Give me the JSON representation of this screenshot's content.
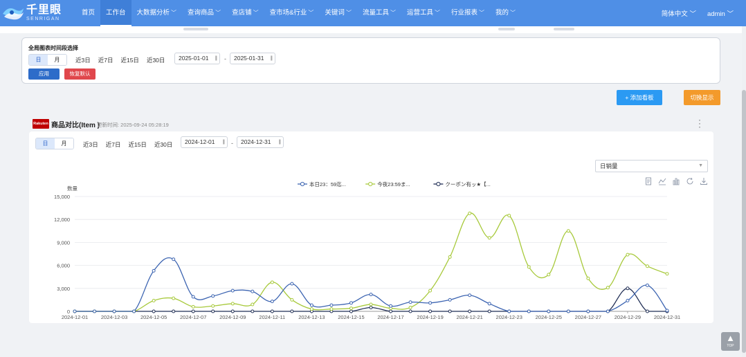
{
  "app": {
    "logo_cn": "千里眼",
    "logo_en": "SENRIGAN"
  },
  "nav": {
    "items": [
      {
        "label": "首页",
        "dropdown": false
      },
      {
        "label": "工作台",
        "dropdown": false,
        "active": true
      },
      {
        "label": "大数据分析",
        "dropdown": true
      },
      {
        "label": "查询商品",
        "dropdown": true
      },
      {
        "label": "查店铺",
        "dropdown": true
      },
      {
        "label": "查市场&行业",
        "dropdown": true
      },
      {
        "label": "关键词",
        "dropdown": true
      },
      {
        "label": "流量工具",
        "dropdown": true
      },
      {
        "label": "运营工具",
        "dropdown": true
      },
      {
        "label": "行业报表",
        "dropdown": true
      },
      {
        "label": "我的",
        "dropdown": true
      }
    ],
    "language": "简体中文",
    "user": "admin"
  },
  "global_filter": {
    "title": "全局图表时间段选择",
    "granularity": [
      "日",
      "月"
    ],
    "quick_ranges": [
      "近3日",
      "近7日",
      "近15日",
      "近30日"
    ],
    "start_date": "2025-01-01",
    "end_date": "2025-01-31",
    "separator": "-",
    "apply_label": "应用",
    "reset_label": "恢复默认"
  },
  "actions": {
    "add_board_label": "+ 添加看板",
    "switch_view_label": "切换显示"
  },
  "widget": {
    "brand": "Rakuten",
    "title": "商品对比(Item )",
    "updated": "更新时间: 2025-09-24 05:28:19",
    "granularity": [
      "日",
      "月"
    ],
    "quick_ranges": [
      "近3日",
      "近7日",
      "近15日",
      "近30日"
    ],
    "start_date": "2024-12-01",
    "end_date": "2024-12-31",
    "separator": "-",
    "metric": "日销量"
  },
  "chart_data": {
    "type": "line",
    "ylabel": "数量",
    "ylim": [
      0,
      15000
    ],
    "yticks": [
      "0",
      "3,000",
      "6,000",
      "9,000",
      "12,000",
      "15,000"
    ],
    "x": [
      "2024-12-01",
      "2024-12-02",
      "2024-12-03",
      "2024-12-04",
      "2024-12-05",
      "2024-12-06",
      "2024-12-07",
      "2024-12-08",
      "2024-12-09",
      "2024-12-10",
      "2024-12-11",
      "2024-12-12",
      "2024-12-13",
      "2024-12-14",
      "2024-12-15",
      "2024-12-16",
      "2024-12-17",
      "2024-12-18",
      "2024-12-19",
      "2024-12-20",
      "2024-12-21",
      "2024-12-22",
      "2024-12-23",
      "2024-12-24",
      "2024-12-25",
      "2024-12-26",
      "2024-12-27",
      "2024-12-28",
      "2024-12-29",
      "2024-12-30",
      "2024-12-31"
    ],
    "xticks": [
      "2024-12-01",
      "2024-12-03",
      "2024-12-05",
      "2024-12-07",
      "2024-12-09",
      "2024-12-11",
      "2024-12-13",
      "2024-12-15",
      "2024-12-17",
      "2024-12-19",
      "2024-12-21",
      "2024-12-23",
      "2024-12-25",
      "2024-12-27",
      "2024-12-29",
      "2024-12-31"
    ],
    "legend_position": "top-center",
    "series": [
      {
        "name": "本日23：59迄...",
        "color": "#3c64b1",
        "values": [
          0,
          0,
          0,
          0,
          5300,
          6800,
          1900,
          2000,
          2700,
          2600,
          1300,
          3600,
          800,
          800,
          1100,
          2200,
          700,
          1200,
          1100,
          1500,
          2100,
          1000,
          0,
          0,
          0,
          0,
          0,
          0,
          1400,
          3400,
          100
        ]
      },
      {
        "name": "今夜23:59ま...",
        "color": "#a7c93a",
        "values": [
          0,
          0,
          0,
          0,
          1400,
          1700,
          600,
          700,
          1000,
          900,
          3800,
          1500,
          300,
          300,
          400,
          900,
          400,
          500,
          2700,
          7100,
          12800,
          9600,
          12500,
          5800,
          4800,
          10500,
          4300,
          3100,
          7400,
          5900,
          4900
        ]
      },
      {
        "name": "クーポン有ッ★【...",
        "color": "#1f2d54",
        "values": [
          0,
          0,
          0,
          0,
          0,
          0,
          0,
          0,
          0,
          0,
          0,
          0,
          0,
          0,
          0,
          500,
          0,
          0,
          0,
          0,
          0,
          0,
          0,
          0,
          0,
          0,
          0,
          0,
          3000,
          0,
          0
        ]
      }
    ]
  }
}
